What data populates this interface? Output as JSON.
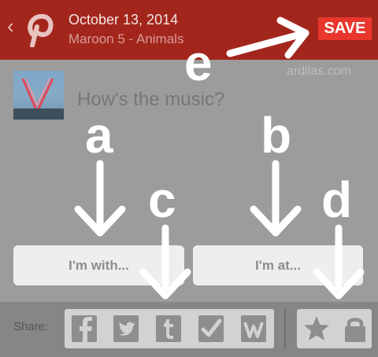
{
  "header": {
    "back_glyph": "‹",
    "logo_icon": "pinterest-logo",
    "date": "October 13, 2014",
    "subtitle": "Maroon 5 - Animals",
    "save_label": "SAVE"
  },
  "watermark": "ardilas.com",
  "main": {
    "album_icon": "album-cover",
    "prompt": "How's the music?",
    "with_button": "I'm with...",
    "at_button": "I'm at..."
  },
  "share": {
    "label": "Share:",
    "icons": [
      "facebook-icon",
      "twitter-icon",
      "tumblr-icon",
      "checkmark-icon",
      "wordpress-icon"
    ],
    "privacy_icons": [
      "star-icon",
      "lock-icon"
    ]
  },
  "annotations": [
    "a",
    "b",
    "c",
    "d",
    "e"
  ],
  "colors": {
    "header_bg": "#a3261d",
    "save_bg": "#e9372e",
    "overlay_bg": "#9c9c9c",
    "bottom_bar": "#868686",
    "icon_color": "#8e8e8e"
  }
}
